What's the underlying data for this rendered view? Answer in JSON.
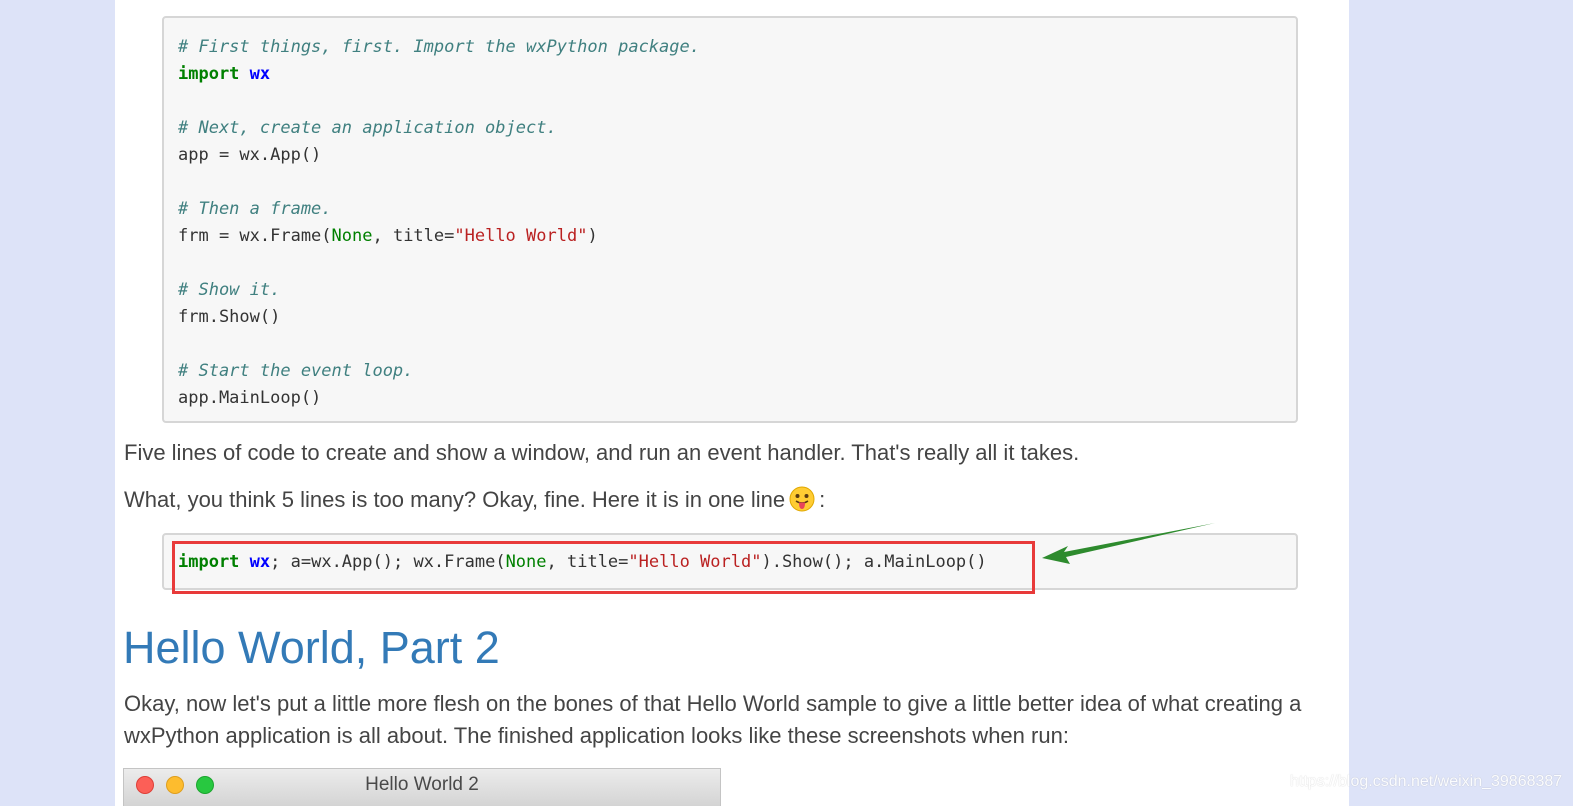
{
  "code_main": {
    "line1": "# First things, first. Import the wxPython package.",
    "line2_kw": "import",
    "line2_mod": "wx",
    "line4": "# Next, create an application object.",
    "line5": "app = wx.App()",
    "line7": "# Then a frame.",
    "line8_a": "frm = wx.Frame(",
    "line8_none": "None",
    "line8_b": ", title=",
    "line8_str": "\"Hello World\"",
    "line8_c": ")",
    "line10": "# Show it.",
    "line11": "frm.Show()",
    "line13": "# Start the event loop.",
    "line14": "app.MainLoop()"
  },
  "para1": "Five lines of code to create and show a window, and run an event handler. That's really all it takes.",
  "para2_before": "What, you think 5 lines is too many? Okay, fine. Here it is in one line",
  "para2_after": ":",
  "code_oneline": {
    "kw": "import",
    "mod": "wx",
    "a": "; a=wx.App(); wx.Frame(",
    "none": "None",
    "b": ", title=",
    "str": "\"Hello World\"",
    "c": ").Show(); a.MainLoop()"
  },
  "heading": "Hello World, Part 2",
  "para3": "Okay, now let's put a little more flesh on the bones of that Hello World sample to give a little better idea of what creating a wxPython application is all about. The finished application looks like these screenshots when run:",
  "window_title": "Hello World 2",
  "watermark": "https://blog.csdn.net/weixin_39868387",
  "colors": {
    "heading": "#337ab7",
    "highlight": "#e83a3a",
    "arrow": "#2e8b2e"
  }
}
